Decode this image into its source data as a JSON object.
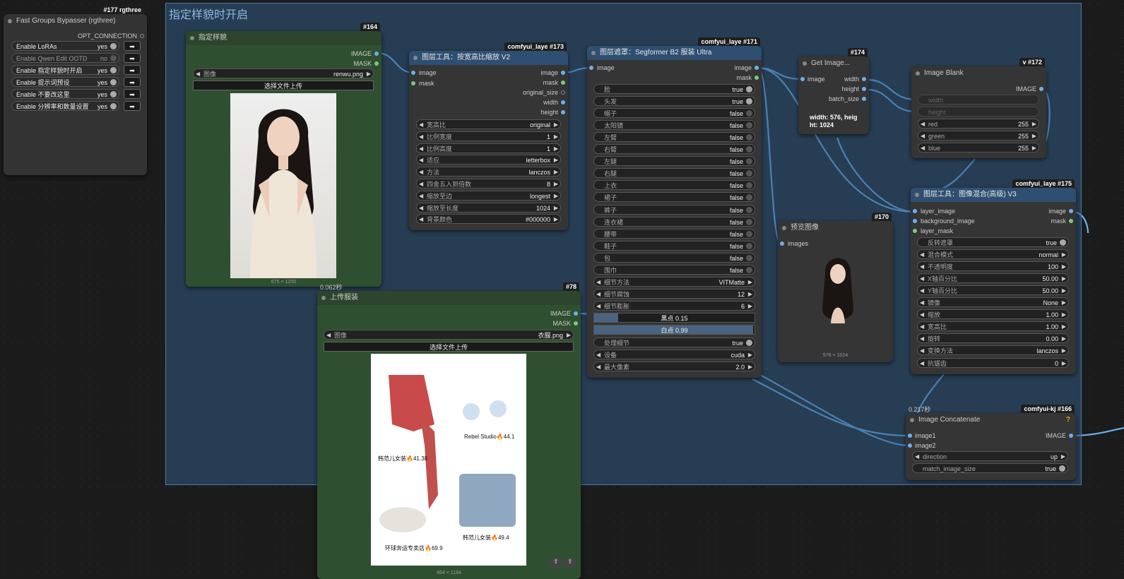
{
  "group": {
    "title": "指定样貌时开启"
  },
  "n177": {
    "badge": "#177 rgthree",
    "title": "Fast Groups Bypasser (rgthree)",
    "output": "OPT_CONNECTION",
    "rows": [
      {
        "label": "Enable LoRAs",
        "value": "yes",
        "on": true
      },
      {
        "label": "Enable Qwen Edit OOTD",
        "value": "no",
        "on": false
      },
      {
        "label": "Enable 指定样貌时开启",
        "value": "yes",
        "on": true
      },
      {
        "label": "Enable 提示词预设",
        "value": "yes",
        "on": true
      },
      {
        "label": "Enable 不要改这里",
        "value": "yes",
        "on": true
      },
      {
        "label": "Enable 分辨率和数量设置",
        "value": "yes",
        "on": true
      }
    ]
  },
  "n164": {
    "badge": "#164",
    "title": "指定样貌",
    "out1": "IMAGE",
    "out2": "MASK",
    "image_label": "图像",
    "image_value": "renwu.png",
    "upload": "选择文件上传",
    "size": "675 × 1200"
  },
  "n173": {
    "badge": "comfyui_laye #173",
    "title": "图层工具：按宽高比缩放 V2",
    "in1": "image",
    "in2": "mask",
    "outs": [
      "image",
      "mask",
      "original_size",
      "width",
      "height"
    ],
    "params": [
      {
        "label": "宽高比",
        "value": "original"
      },
      {
        "label": "比例宽度",
        "value": "1"
      },
      {
        "label": "比例高度",
        "value": "1"
      },
      {
        "label": "适应",
        "value": "letterbox"
      },
      {
        "label": "方法",
        "value": "lanczos"
      },
      {
        "label": "四舍五入到倍数",
        "value": "8"
      },
      {
        "label": "缩放至边",
        "value": "longest"
      },
      {
        "label": "缩放至长度",
        "value": "1024"
      },
      {
        "label": "背景颜色",
        "value": "#000000"
      }
    ]
  },
  "n171": {
    "badge": "comfyui_laye #171",
    "title": "图层遮罩：Segformer B2 服装 Ultra",
    "in1": "image",
    "out1": "image",
    "out2": "mask",
    "params": [
      {
        "label": "脸",
        "value": "true",
        "kind": "toggle"
      },
      {
        "label": "头发",
        "value": "true",
        "kind": "toggle"
      },
      {
        "label": "帽子",
        "value": "false",
        "kind": "toggle"
      },
      {
        "label": "太阳镜",
        "value": "false",
        "kind": "toggle"
      },
      {
        "label": "左臂",
        "value": "false",
        "kind": "toggle"
      },
      {
        "label": "右臂",
        "value": "false",
        "kind": "toggle"
      },
      {
        "label": "左腿",
        "value": "false",
        "kind": "toggle"
      },
      {
        "label": "右腿",
        "value": "false",
        "kind": "toggle"
      },
      {
        "label": "上衣",
        "value": "false",
        "kind": "toggle"
      },
      {
        "label": "裙子",
        "value": "false",
        "kind": "toggle"
      },
      {
        "label": "裤子",
        "value": "false",
        "kind": "toggle"
      },
      {
        "label": "连衣裙",
        "value": "false",
        "kind": "toggle"
      },
      {
        "label": "腰带",
        "value": "false",
        "kind": "toggle"
      },
      {
        "label": "鞋子",
        "value": "false",
        "kind": "toggle"
      },
      {
        "label": "包",
        "value": "false",
        "kind": "toggle"
      },
      {
        "label": "围巾",
        "value": "false",
        "kind": "toggle"
      },
      {
        "label": "细节方法",
        "value": "VITMatte",
        "kind": "combo"
      },
      {
        "label": "细节腐蚀",
        "value": "12",
        "kind": "combo"
      },
      {
        "label": "细节膨胀",
        "value": "6",
        "kind": "combo"
      }
    ],
    "black_point": {
      "text": "黑点 0.15",
      "fraction": 0.15
    },
    "white_point": {
      "text": "白点 0.99",
      "fraction": 0.99
    },
    "params2": [
      {
        "label": "处理细节",
        "value": "true",
        "kind": "toggle"
      },
      {
        "label": "设备",
        "value": "cuda",
        "kind": "combo"
      },
      {
        "label": "最大像素",
        "value": "2.0",
        "kind": "combo"
      }
    ]
  },
  "n174": {
    "badge": "#174",
    "title": "Get Image...",
    "in1": "image",
    "outs": [
      "width",
      "height",
      "batch_size"
    ],
    "info1": "width: 576, heig",
    "info2": "ht: 1024"
  },
  "n172": {
    "badge": "v #172",
    "title": "Image Blank",
    "out1": "IMAGE",
    "w_disabled": [
      "width",
      "height"
    ],
    "params": [
      {
        "label": "red",
        "value": "255"
      },
      {
        "label": "green",
        "value": "255"
      },
      {
        "label": "blue",
        "value": "255"
      }
    ]
  },
  "n170": {
    "badge": "#170",
    "title": "预览图像",
    "in1": "images",
    "size": "576 × 1024"
  },
  "n175": {
    "badge": "comfyui_laye #175",
    "title": "图层工具：图像混合(高级) V3",
    "ins": [
      "layer_image",
      "background_image",
      "layer_mask"
    ],
    "outs": [
      "image",
      "mask"
    ],
    "params": [
      {
        "label": "反转遮罩",
        "value": "true",
        "kind": "toggle"
      },
      {
        "label": "混合模式",
        "value": "normal",
        "kind": "combo"
      },
      {
        "label": "不透明度",
        "value": "100",
        "kind": "combo"
      },
      {
        "label": "X轴百分比",
        "value": "50.00",
        "kind": "combo"
      },
      {
        "label": "Y轴百分比",
        "value": "50.00",
        "kind": "combo"
      },
      {
        "label": "镜像",
        "value": "None",
        "kind": "combo"
      },
      {
        "label": "缩放",
        "value": "1.00",
        "kind": "combo"
      },
      {
        "label": "宽高比",
        "value": "1.00",
        "kind": "combo"
      },
      {
        "label": "旋转",
        "value": "0.00",
        "kind": "combo"
      },
      {
        "label": "变换方法",
        "value": "lanczos",
        "kind": "combo"
      },
      {
        "label": "抗锯齿",
        "value": "0",
        "kind": "combo"
      }
    ]
  },
  "n78": {
    "badge": "#78",
    "timing": "0.062秒",
    "title": "上传服装",
    "out1": "IMAGE",
    "out2": "MASK",
    "image_label": "图像",
    "image_value": "衣服.png",
    "upload": "选择文件上传",
    "size": "864 × 1184",
    "captions": [
      "Rebel Studio🔥44.1",
      "韩范儿女装🔥41.38",
      "环球奔运专卖店🔥69.9",
      "韩范儿女装🔥49.4"
    ]
  },
  "n166": {
    "badge": "comfyui-kj #166",
    "timing": "0.217秒",
    "title": "Image Concatenate",
    "help": "?",
    "ins": [
      "image1",
      "image2"
    ],
    "out1": "IMAGE",
    "params": [
      {
        "label": "direction",
        "value": "up",
        "kind": "combo"
      },
      {
        "label": "match_image_size",
        "value": "true",
        "kind": "toggle"
      }
    ]
  },
  "colors": {
    "link": "#6ab0f0",
    "green_node": "#2f5030",
    "group": "#325a82"
  }
}
